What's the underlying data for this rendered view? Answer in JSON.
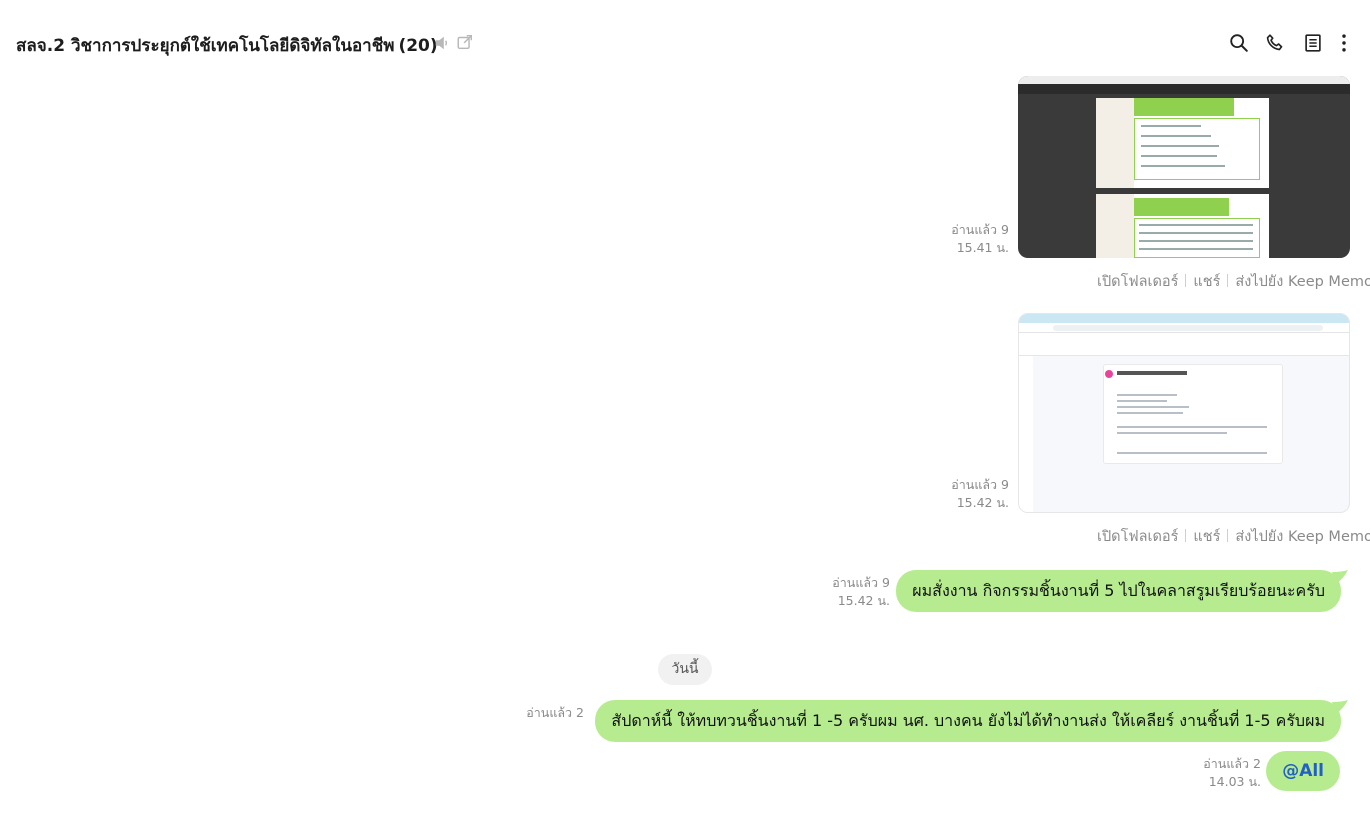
{
  "header": {
    "title": "สลจ.2 วิชาการประยุกต์ใช้เทคโนโลยีดิจิทัลในอาชีพ",
    "member_count": "(20)",
    "icons": [
      "mute-icon",
      "external-window-icon",
      "search-icon",
      "phone-icon",
      "note-icon",
      "more-vertical-icon"
    ]
  },
  "messages": [
    {
      "type": "image",
      "read": "อ่านแล้ว 9",
      "time": "15.41 น.",
      "actions": [
        "เปิดโฟลเดอร์",
        "แชร์",
        "ส่งไปยัง Keep Memo"
      ]
    },
    {
      "type": "image",
      "read": "อ่านแล้ว 9",
      "time": "15.42 น.",
      "actions": [
        "เปิดโฟลเดอร์",
        "แชร์",
        "ส่งไปยัง Keep Memo"
      ]
    },
    {
      "type": "text",
      "read": "อ่านแล้ว 9",
      "time": "15.42 น.",
      "text": "ผมสั่งงาน กิจกรรมชิ้นงานที่ 5 ไปในคลาสรูมเรียบร้อยนะครับ"
    },
    {
      "type": "text",
      "read": "อ่านแล้ว 2",
      "time": "",
      "text": "สัปดาห์นี้ ให้ทบทวนชิ้นงานที่ 1 -5 ครับผม นศ. บางคน ยังไม่ได้ทำงานส่ง ให้เคลียร์ งานชิ้นที่ 1-5 ครับผม"
    },
    {
      "type": "text",
      "read": "อ่านแล้ว 2",
      "time": "14.03 น.",
      "text": "@All"
    }
  ],
  "day_separator": "วันนี้",
  "colors": {
    "bubble": "#b6ec8f",
    "mention": "#2360c4",
    "meta_text": "#8a8a8a"
  }
}
